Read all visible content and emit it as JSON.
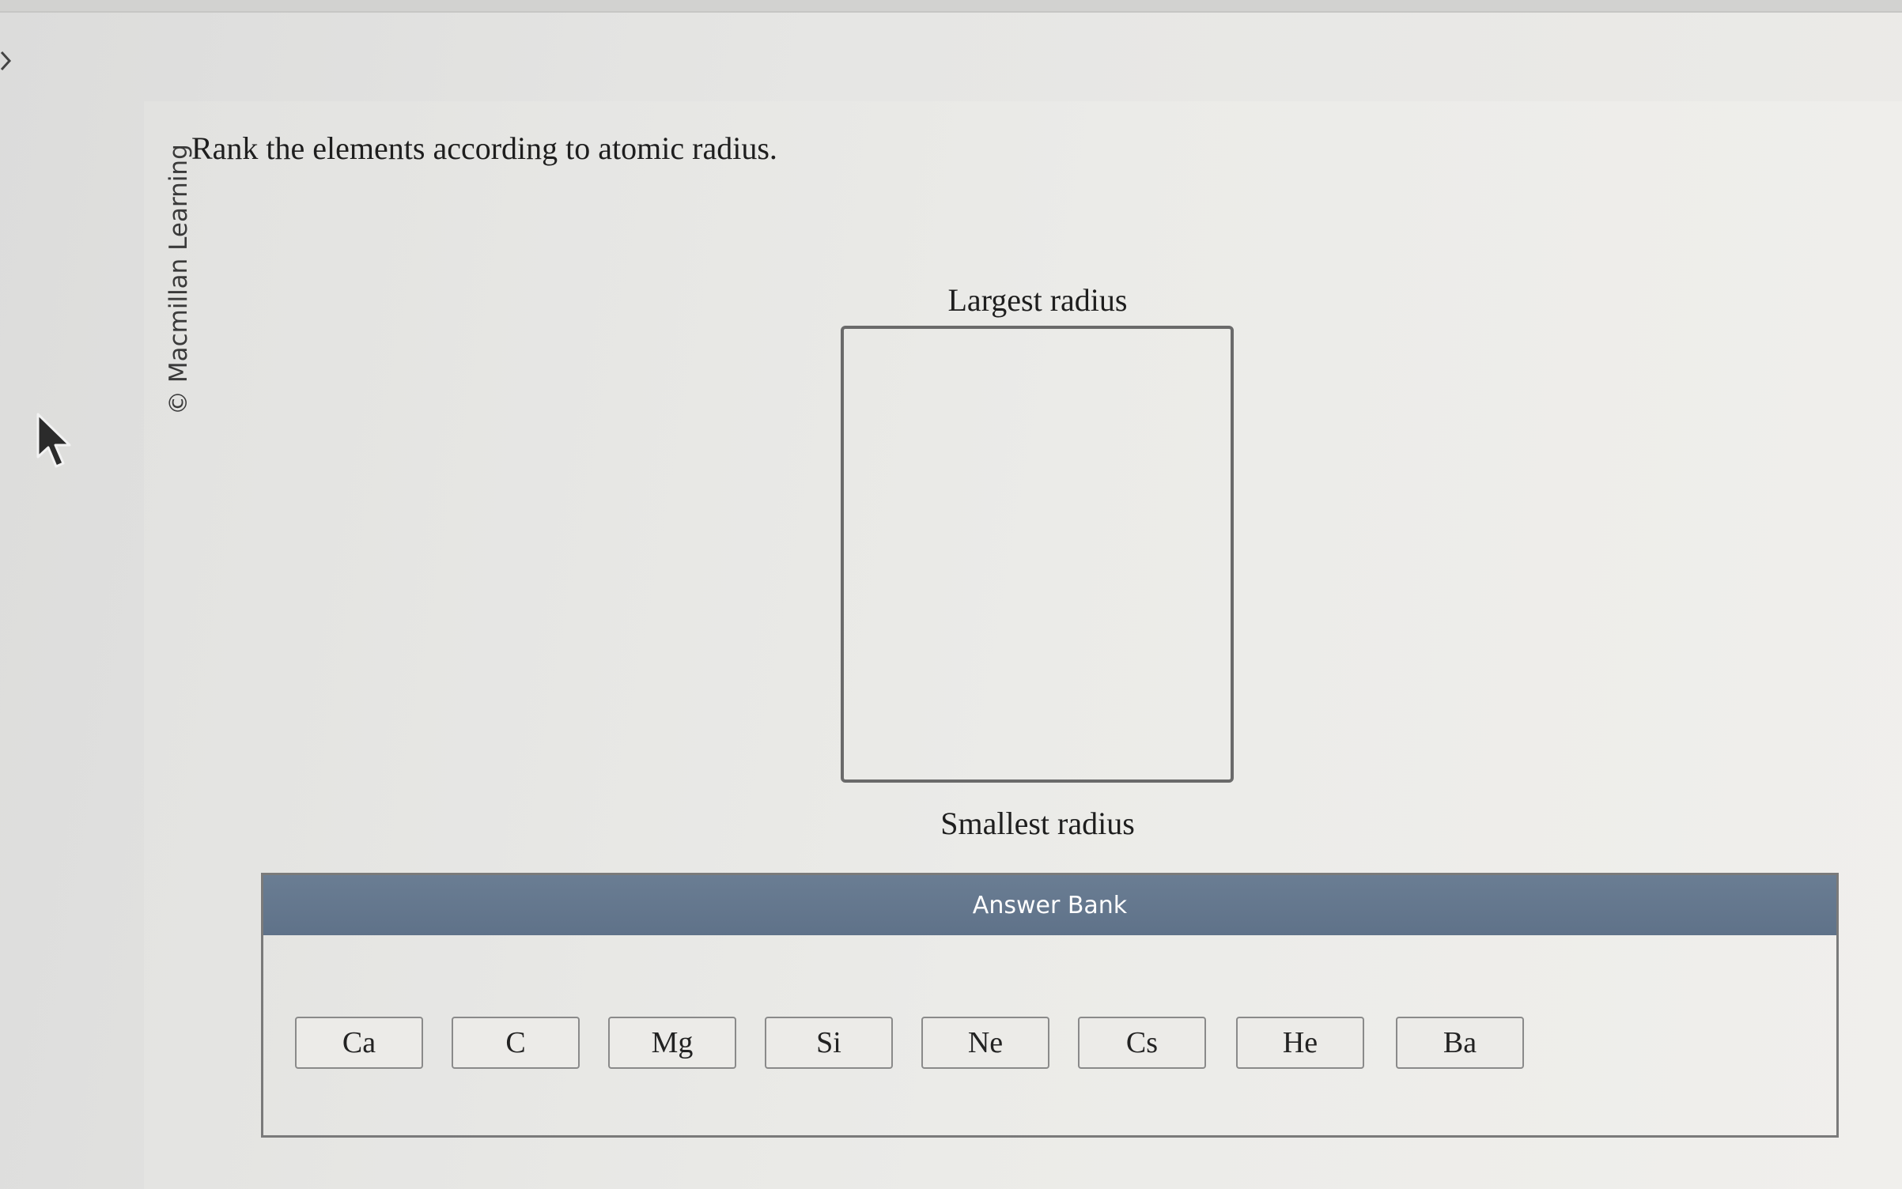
{
  "credit": "© Macmillan Learning",
  "question": "Rank the elements according to atomic radius.",
  "ranking": {
    "top_label": "Largest radius",
    "bottom_label": "Smallest radius"
  },
  "answer_bank": {
    "title": "Answer Bank",
    "items": [
      "Ca",
      "C",
      "Mg",
      "Si",
      "Ne",
      "Cs",
      "He",
      "Ba"
    ]
  }
}
